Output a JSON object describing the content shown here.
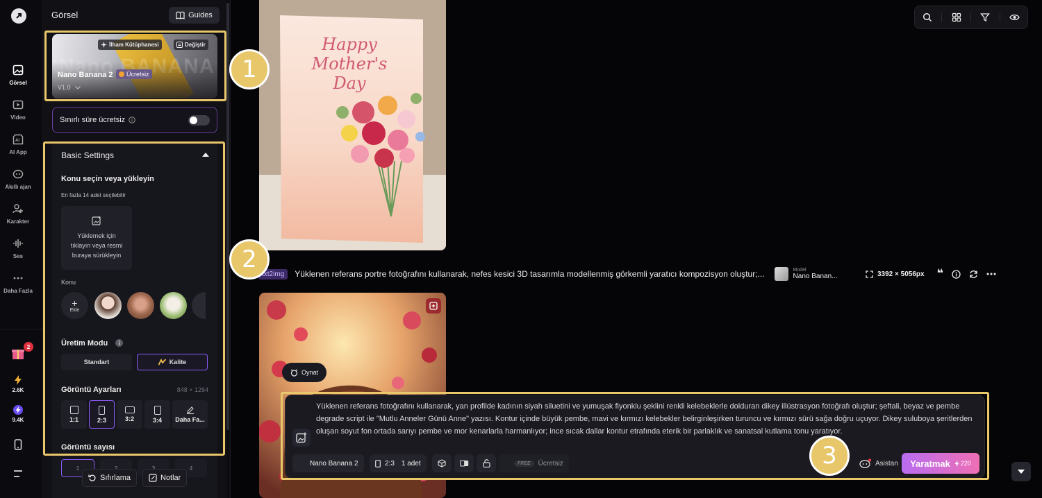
{
  "rail": {
    "items": [
      {
        "label": "Görsel",
        "icon": "image-icon"
      },
      {
        "label": "Video",
        "icon": "video-icon"
      },
      {
        "label": "AI App",
        "icon": "ai-app-icon"
      },
      {
        "label": "Akıllı ajan",
        "icon": "agent-icon"
      },
      {
        "label": "Karakter",
        "icon": "character-icon"
      },
      {
        "label": "Ses",
        "icon": "audio-icon"
      },
      {
        "label": "Daha Fazla",
        "icon": "more-icon"
      }
    ],
    "gift_badge": "2",
    "credits_1": "2.6K",
    "credits_2": "9.4K"
  },
  "panel": {
    "title": "Görsel",
    "guides": "Guides",
    "model": {
      "brand": "Nano BANANA 2",
      "inspiration": "İlham Kütüphanesi",
      "change": "Değiştir",
      "name": "Nano Banana 2",
      "price": "Ücretsiz",
      "version": "V1.0"
    },
    "limited": "Sınırlı süre ücretsiz",
    "basic": {
      "title": "Basic Settings",
      "subject_title": "Konu seçin veya yükleyin",
      "subject_hint": "En fazla 14 adet seçilebilir",
      "upload_text": [
        "Yüklemek için",
        "tıklayın veya resmi",
        "buraya sürükleyin"
      ],
      "konu_label": "Konu",
      "add_label": "Ekle",
      "mode_title": "Üretim Modu",
      "modes": [
        "Standart",
        "Kalite"
      ],
      "image_settings": "Görüntü Ayarları",
      "dimensions": "848 × 1264",
      "ratios": [
        "1:1",
        "2:3",
        "3:2",
        "3:4",
        "Daha Fa..."
      ],
      "count_title": "Görüntü sayısı",
      "counts": [
        "1",
        "2",
        "3",
        "4"
      ]
    },
    "reset": "Sıfırlama",
    "notes": "Notlar"
  },
  "main": {
    "card1": {
      "line1": "Happy",
      "line2": "Mother's",
      "line3": "Day"
    },
    "meta": {
      "tag": "txt2img",
      "prompt": "Yüklenen referans portre fotoğrafını kullanarak, nefes kesici 3D tasarımla modellenmiş görkemli yaratıcı kompozisyon oluştur;...",
      "model_caption": "Model",
      "model_name": "Nano Banan...",
      "size": "3392 × 5056px"
    },
    "play": "Oynat",
    "prompt_box": {
      "text": "Yüklenen referans fotoğrafını kullanarak, yan profilde kadının siyah siluetini ve yumuşak fiyonklu şeklini renkli kelebeklerle dolduran dikey illüstrasyon fotoğrafı oluştur; şeftali, beyaz ve pembe degrade script ile \"Mutlu Anneler Günü Anne\" yazısı. Kontur içinde büyük pembe, mavi ve kırmızı kelebekler belirginleşirken turuncu ve kırmızı sürü sağa doğru uçuyor. Dikey suluboya şeritlerden oluşan soyut fon ortada sarıyı pembe ve mor kenarlarla harmanlıyor; ince sıcak dallar kontur etrafında eterik bir parlaklık ve sanatsal kutlama tonu yaratıyor.",
      "model": "Nano Banana 2",
      "ratio": "2:3",
      "count": "1 adet",
      "free_tag": "FREE",
      "price": "Ücretsiz",
      "assistant": "Asistan",
      "create": "Yaratmak",
      "cost": "220"
    }
  },
  "annotations": [
    "1",
    "2",
    "3"
  ],
  "colors": {
    "accent": "#8b5cf6",
    "highlight": "#e9c76a",
    "create_from": "#b86cf0",
    "create_to": "#ef6fb4"
  }
}
